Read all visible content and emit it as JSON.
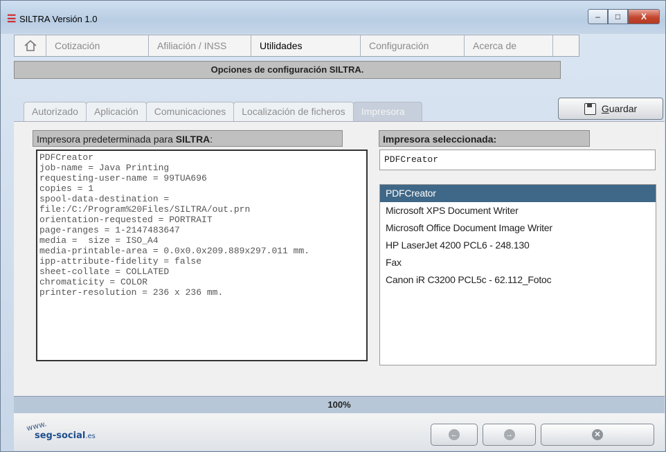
{
  "window": {
    "title": "SILTRA Versión 1.0"
  },
  "menu": {
    "items": [
      {
        "label": "Cotización"
      },
      {
        "label": "Afiliación / INSS"
      },
      {
        "label": "Utilidades"
      },
      {
        "label": "Configuración"
      },
      {
        "label": "Acerca de"
      }
    ]
  },
  "header": {
    "title": "Opciones de configuración SILTRA."
  },
  "tabs": [
    {
      "label": "Autorizado"
    },
    {
      "label": "Aplicación"
    },
    {
      "label": "Comunicaciones"
    },
    {
      "label": "Localización de ficheros"
    },
    {
      "label": "Impresora"
    }
  ],
  "save": {
    "label_prefix": "G",
    "label_rest": "uardar"
  },
  "left_panel": {
    "label_prefix": "Impresora predeterminada para ",
    "label_bold": "SILTRA",
    "label_suffix": ":",
    "lines": [
      "PDFCreator",
      "job-name = Java Printing",
      "requesting-user-name = 99TUA696",
      "copies = 1",
      "spool-data-destination =",
      "file:/C:/Program%20Files/SILTRA/out.prn",
      "orientation-requested = PORTRAIT",
      "page-ranges = 1-2147483647",
      "media =  size = ISO_A4",
      "media-printable-area = 0.0x0.0x209.889x297.011 mm.",
      "ipp-attribute-fidelity = false",
      "sheet-collate = COLLATED",
      "chromaticity = COLOR",
      "printer-resolution = 236 x 236 mm."
    ]
  },
  "right_panel": {
    "label": "Impresora seleccionada:",
    "selected_value": "PDFCreator",
    "printers": [
      "PDFCreator",
      "Microsoft XPS Document Writer",
      "Microsoft Office Document Image Writer",
      "HP LaserJet 4200 PCL6 - 248.130",
      "Fax",
      "Canon iR C3200 PCL5c - 62.112_Fotoc"
    ]
  },
  "progress": {
    "value": 100,
    "label": "100%"
  },
  "footer": {
    "logo_www": "www.",
    "logo_brand": "seg-social",
    "logo_tld": ".es"
  }
}
